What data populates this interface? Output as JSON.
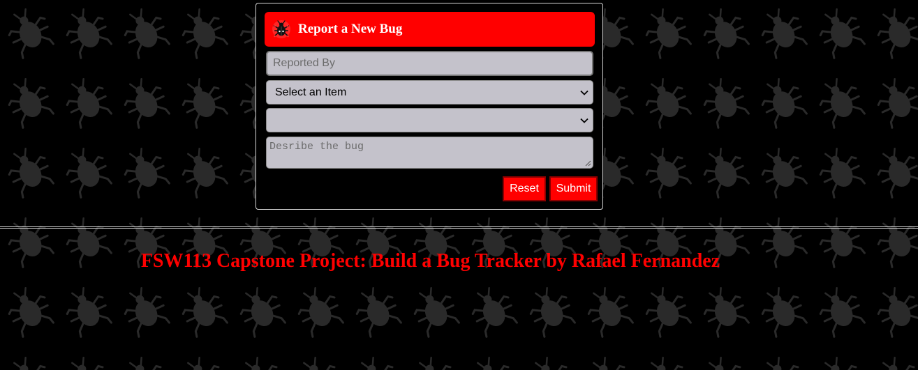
{
  "form": {
    "title": "Report a New Bug",
    "reported_by_placeholder": "Reported By",
    "item_select_value": "Select an Item",
    "second_select_value": "",
    "description_placeholder": "Desribe the bug",
    "reset_label": "Reset",
    "submit_label": "Submit"
  },
  "footer": {
    "title": "FSW113 Capstone Project: Build a Bug Tracker by Rafael Fernandez"
  },
  "colors": {
    "accent": "#ff0000",
    "background": "#000000",
    "field_bg": "#c4c2cb"
  },
  "icons": {
    "header_icon": "bug-icon",
    "background_pattern": "bug-silhouette-pattern"
  }
}
